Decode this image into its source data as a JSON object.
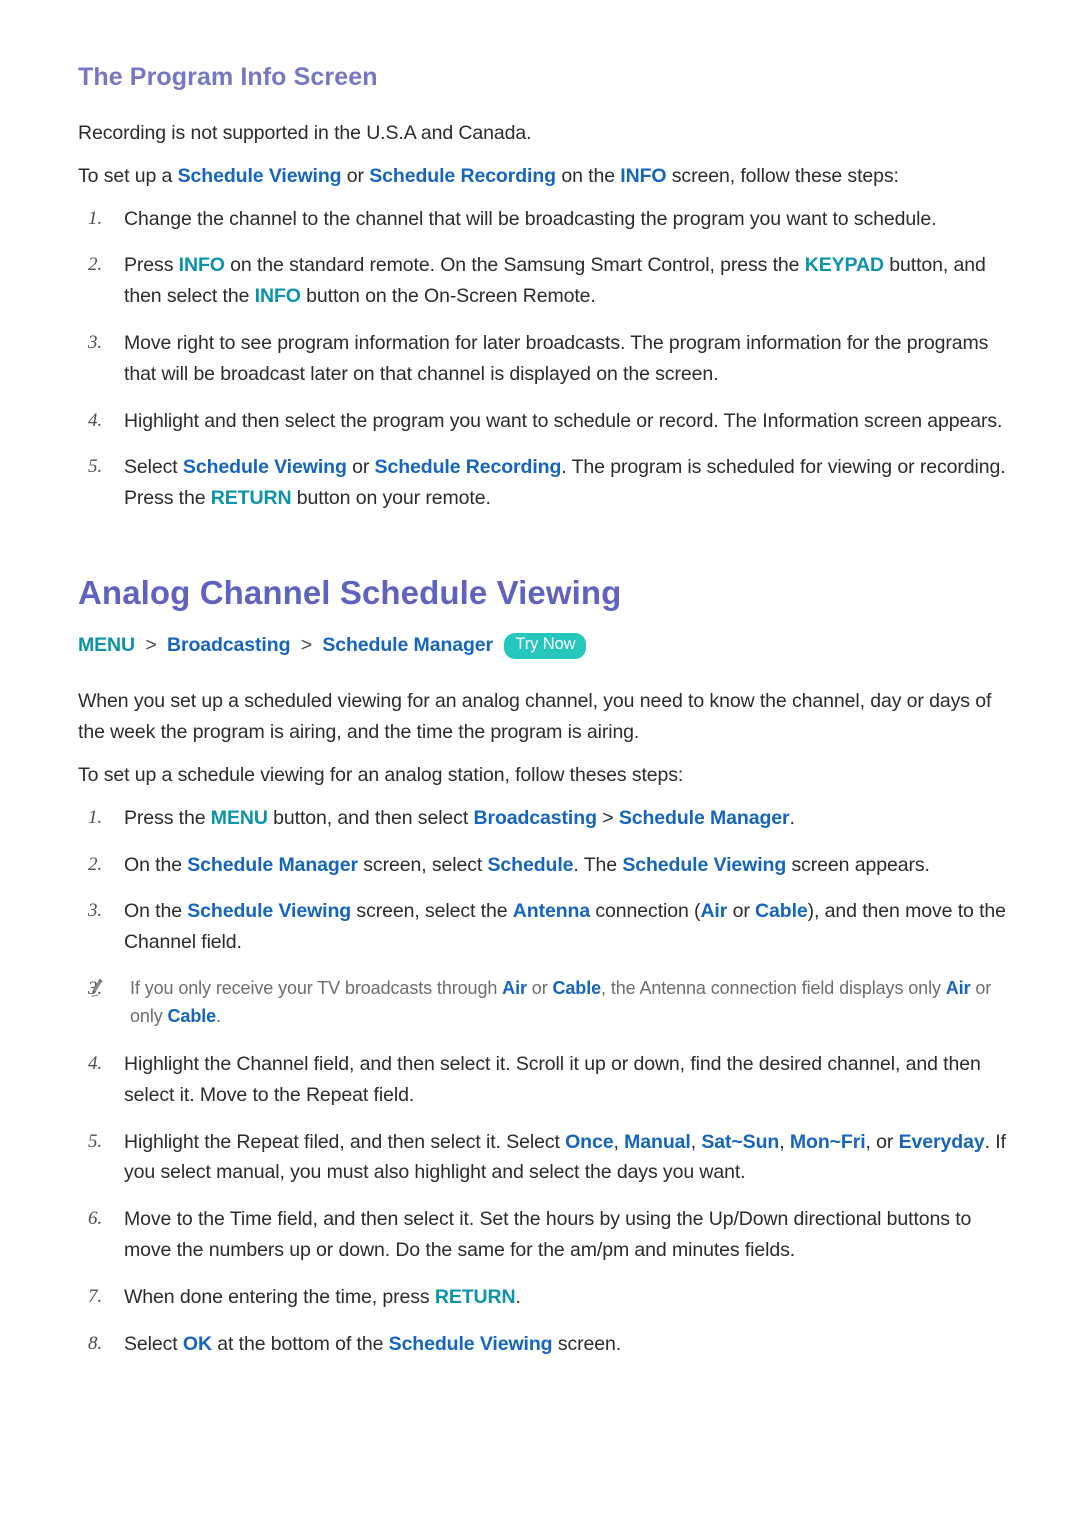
{
  "colors": {
    "sub_heading": "#7478c4",
    "main_heading": "#5f63be",
    "ui_term": "#1565c0",
    "remote_button_term": "#0b93ab",
    "try_now_badge": "#25c6bd",
    "body_text": "#2b2b2b",
    "note_text": "#6d6d6d",
    "page_background": "#ffffff"
  },
  "section1": {
    "heading": "The Program Info Screen",
    "paragraphs": [
      {
        "id": "p1",
        "runs": [
          {
            "text": "Recording is not supported in the U.S.A and Canada.",
            "style": "plain"
          }
        ]
      },
      {
        "id": "p2",
        "runs": [
          {
            "text": "To set up a ",
            "style": "plain"
          },
          {
            "text": "Schedule Viewing",
            "style": "ui"
          },
          {
            "text": " or ",
            "style": "plain"
          },
          {
            "text": "Schedule Recording",
            "style": "ui"
          },
          {
            "text": " on the ",
            "style": "plain"
          },
          {
            "text": "INFO",
            "style": "ui"
          },
          {
            "text": " screen, follow these steps:",
            "style": "plain"
          }
        ]
      }
    ],
    "steps": [
      {
        "number": "1.",
        "runs": [
          {
            "text": "Change the channel to the channel that will be broadcasting the program you want to schedule.",
            "style": "plain"
          }
        ]
      },
      {
        "number": "2.",
        "runs": [
          {
            "text": "Press ",
            "style": "plain"
          },
          {
            "text": "INFO",
            "style": "btn"
          },
          {
            "text": " on the standard remote. On the Samsung Smart Control, press the ",
            "style": "plain"
          },
          {
            "text": "KEYPAD",
            "style": "btn"
          },
          {
            "text": " button, and then select the ",
            "style": "plain"
          },
          {
            "text": "INFO",
            "style": "btn"
          },
          {
            "text": " button on the On-Screen Remote.",
            "style": "plain"
          }
        ]
      },
      {
        "number": "3.",
        "runs": [
          {
            "text": "Move right to see program information for later broadcasts. The program information for the programs that will be broadcast later on that channel is displayed on the screen.",
            "style": "plain"
          }
        ]
      },
      {
        "number": "4.",
        "runs": [
          {
            "text": "Highlight and then select the program you want to schedule or record. The Information screen appears.",
            "style": "plain"
          }
        ]
      },
      {
        "number": "5.",
        "runs": [
          {
            "text": "Select ",
            "style": "plain"
          },
          {
            "text": "Schedule Viewing",
            "style": "ui"
          },
          {
            "text": " or ",
            "style": "plain"
          },
          {
            "text": "Schedule Recording",
            "style": "ui"
          },
          {
            "text": ". The program is scheduled for viewing or recording. Press the ",
            "style": "plain"
          },
          {
            "text": "RETURN",
            "style": "btn"
          },
          {
            "text": " button on your remote.",
            "style": "plain"
          }
        ]
      }
    ]
  },
  "section2": {
    "heading": "Analog Channel Schedule Viewing",
    "breadcrumb": {
      "menu_label": "MENU",
      "separator": ">",
      "items": [
        "Broadcasting",
        "Schedule Manager"
      ],
      "badge": "Try Now"
    },
    "paragraphs": [
      {
        "id": "p1",
        "runs": [
          {
            "text": "When you set up a scheduled viewing for an analog channel, you need to know the channel, day or days of the week the program is airing, and the time the program is airing.",
            "style": "plain"
          }
        ]
      },
      {
        "id": "p2",
        "runs": [
          {
            "text": "To set up a schedule viewing for an analog station, follow theses steps:",
            "style": "plain"
          }
        ]
      }
    ],
    "steps": [
      {
        "number": "1.",
        "runs": [
          {
            "text": "Press the ",
            "style": "plain"
          },
          {
            "text": "MENU",
            "style": "btn"
          },
          {
            "text": " button, and then select ",
            "style": "plain"
          },
          {
            "text": "Broadcasting",
            "style": "ui"
          },
          {
            "text": " > ",
            "style": "plain"
          },
          {
            "text": "Schedule Manager",
            "style": "ui"
          },
          {
            "text": ".",
            "style": "plain"
          }
        ]
      },
      {
        "number": "2.",
        "runs": [
          {
            "text": "On the ",
            "style": "plain"
          },
          {
            "text": "Schedule Manager",
            "style": "ui"
          },
          {
            "text": " screen, select ",
            "style": "plain"
          },
          {
            "text": "Schedule",
            "style": "ui"
          },
          {
            "text": ". The ",
            "style": "plain"
          },
          {
            "text": "Schedule Viewing",
            "style": "ui"
          },
          {
            "text": " screen appears.",
            "style": "plain"
          }
        ]
      },
      {
        "number": "3.",
        "runs": [
          {
            "text": "On the ",
            "style": "plain"
          },
          {
            "text": "Schedule Viewing",
            "style": "ui"
          },
          {
            "text": " screen, select the ",
            "style": "plain"
          },
          {
            "text": "Antenna",
            "style": "ui"
          },
          {
            "text": " connection (",
            "style": "plain"
          },
          {
            "text": "Air",
            "style": "ui"
          },
          {
            "text": " or ",
            "style": "plain"
          },
          {
            "text": "Cable",
            "style": "ui"
          },
          {
            "text": "), and then move to the Channel field.",
            "style": "plain"
          }
        ]
      },
      {
        "number": "4.",
        "runs": [
          {
            "text": "Highlight the Channel field, and then select it. Scroll it up or down, find the desired channel, and then select it. Move to the Repeat field.",
            "style": "plain"
          }
        ]
      },
      {
        "number": "5.",
        "runs": [
          {
            "text": "Highlight the Repeat filed, and then select it. Select ",
            "style": "plain"
          },
          {
            "text": "Once",
            "style": "ui"
          },
          {
            "text": ", ",
            "style": "plain"
          },
          {
            "text": "Manual",
            "style": "ui"
          },
          {
            "text": ", ",
            "style": "plain"
          },
          {
            "text": "Sat~Sun",
            "style": "ui"
          },
          {
            "text": ", ",
            "style": "plain"
          },
          {
            "text": "Mon~Fri",
            "style": "ui"
          },
          {
            "text": ", or ",
            "style": "plain"
          },
          {
            "text": "Everyday",
            "style": "ui"
          },
          {
            "text": ". If you select manual, you must also highlight and select the days you want.",
            "style": "plain"
          }
        ]
      },
      {
        "number": "6.",
        "runs": [
          {
            "text": "Move to the Time field, and then select it. Set the hours by using the Up/Down directional buttons to move the numbers up or down. Do the same for the am/pm and minutes fields.",
            "style": "plain"
          }
        ]
      },
      {
        "number": "7.",
        "runs": [
          {
            "text": "When done entering the time, press ",
            "style": "plain"
          },
          {
            "text": "RETURN",
            "style": "btn"
          },
          {
            "text": ".",
            "style": "plain"
          }
        ]
      },
      {
        "number": "8.",
        "runs": [
          {
            "text": "Select ",
            "style": "plain"
          },
          {
            "text": "OK",
            "style": "ui"
          },
          {
            "text": " at the bottom of the ",
            "style": "plain"
          },
          {
            "text": "Schedule Viewing",
            "style": "ui"
          },
          {
            "text": " screen.",
            "style": "plain"
          }
        ]
      }
    ],
    "note": {
      "icon": "pencil-icon",
      "runs": [
        {
          "text": "If you only receive your TV broadcasts through ",
          "style": "plain"
        },
        {
          "text": "Air",
          "style": "ui"
        },
        {
          "text": " or ",
          "style": "plain"
        },
        {
          "text": "Cable",
          "style": "ui"
        },
        {
          "text": ", the Antenna connection field displays only ",
          "style": "plain"
        },
        {
          "text": "Air",
          "style": "ui"
        },
        {
          "text": " or only ",
          "style": "plain"
        },
        {
          "text": "Cable",
          "style": "ui"
        },
        {
          "text": ".",
          "style": "plain"
        }
      ]
    }
  }
}
